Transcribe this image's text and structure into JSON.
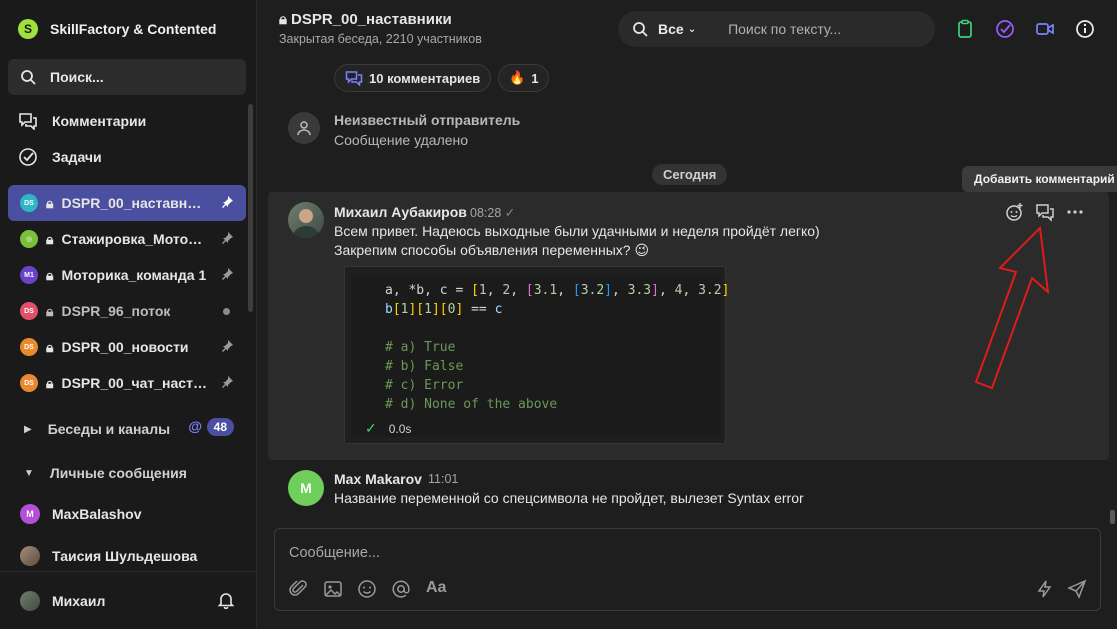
{
  "workspace": {
    "name": "SkillFactory & Contented"
  },
  "sidebar": {
    "search_label": "Поиск...",
    "nav": [
      {
        "label": "Комментарии"
      },
      {
        "label": "Задачи"
      }
    ],
    "chats": [
      {
        "label": "DSPR_00_наставники",
        "avatar": "DS",
        "color": "#2fb5c8",
        "state": "pinned-active"
      },
      {
        "label": "Стажировка_Мотор…",
        "avatar": "◎",
        "color": "#7bbf3a",
        "state": "pinned"
      },
      {
        "label": "Моторика_команда 1",
        "avatar": "M1",
        "color": "#6a43c9",
        "state": "pinned"
      },
      {
        "label": "DSPR_96_поток",
        "avatar": "DS",
        "color": "#e0506b",
        "state": "dot"
      },
      {
        "label": "DSPR_00_новости",
        "avatar": "DS",
        "color": "#e8892e",
        "state": "pinned"
      },
      {
        "label": "DSPR_00_чат_наста…",
        "avatar": "DS",
        "color": "#e8892e",
        "state": "pinned"
      }
    ],
    "channels_label": "Беседы и каналы",
    "channels_mention": "@",
    "channels_badge": "48",
    "dms_label": "Личные сообщения",
    "dms": [
      {
        "label": "MaxBalashov",
        "avatar": "M",
        "color": "#b34fd8"
      },
      {
        "label": "Таисия Шульдешова",
        "avatar": "",
        "color": "#7a6a5a"
      }
    ],
    "me_label": "Михаил"
  },
  "header": {
    "title": "DSPR_00_наставники",
    "subtitle": "Закрытая беседа, 2210 участников",
    "search_scope": "Все",
    "search_placeholder": "Поиск по тексту..."
  },
  "reactions": {
    "comments": "10 комментариев",
    "fire_emoji": "🔥",
    "fire_count": "1"
  },
  "system_message": {
    "sender": "Неизвестный отправитель",
    "text": "Сообщение удалено"
  },
  "date_divider": "Сегодня",
  "tooltip": "Добавить комментарий",
  "message1": {
    "author": "Михаил Аубакиров",
    "time": "08:28",
    "line1": "Всем привет. Надеюсь выходные были удачными и неделя пройдёт легко)",
    "line2": "Закрепим способы объявления переменных? 😉",
    "code": {
      "line1": "a, *b, c = [1, 2, [3.1, [3.2], 3.3], 4, 3.2]",
      "line2": "b[1][1][0] == c",
      "line3": "",
      "line4": "# a) True",
      "line5": "# b) False",
      "line6": "# c) Error",
      "line7": "# d) None of the above",
      "exec_time": "0.0s"
    }
  },
  "message2": {
    "author": "Max Makarov",
    "time": "11:01",
    "avatar": "M",
    "text": "Название переменной со спецсимвола не пройдет, вылезет Syntax error"
  },
  "composer": {
    "placeholder": "Сообщение...",
    "font_tool": "Aa"
  },
  "colors": {
    "accent": "#4a4fa0",
    "highlight": "#2b2b2b",
    "arrow": "#e01b1b"
  }
}
